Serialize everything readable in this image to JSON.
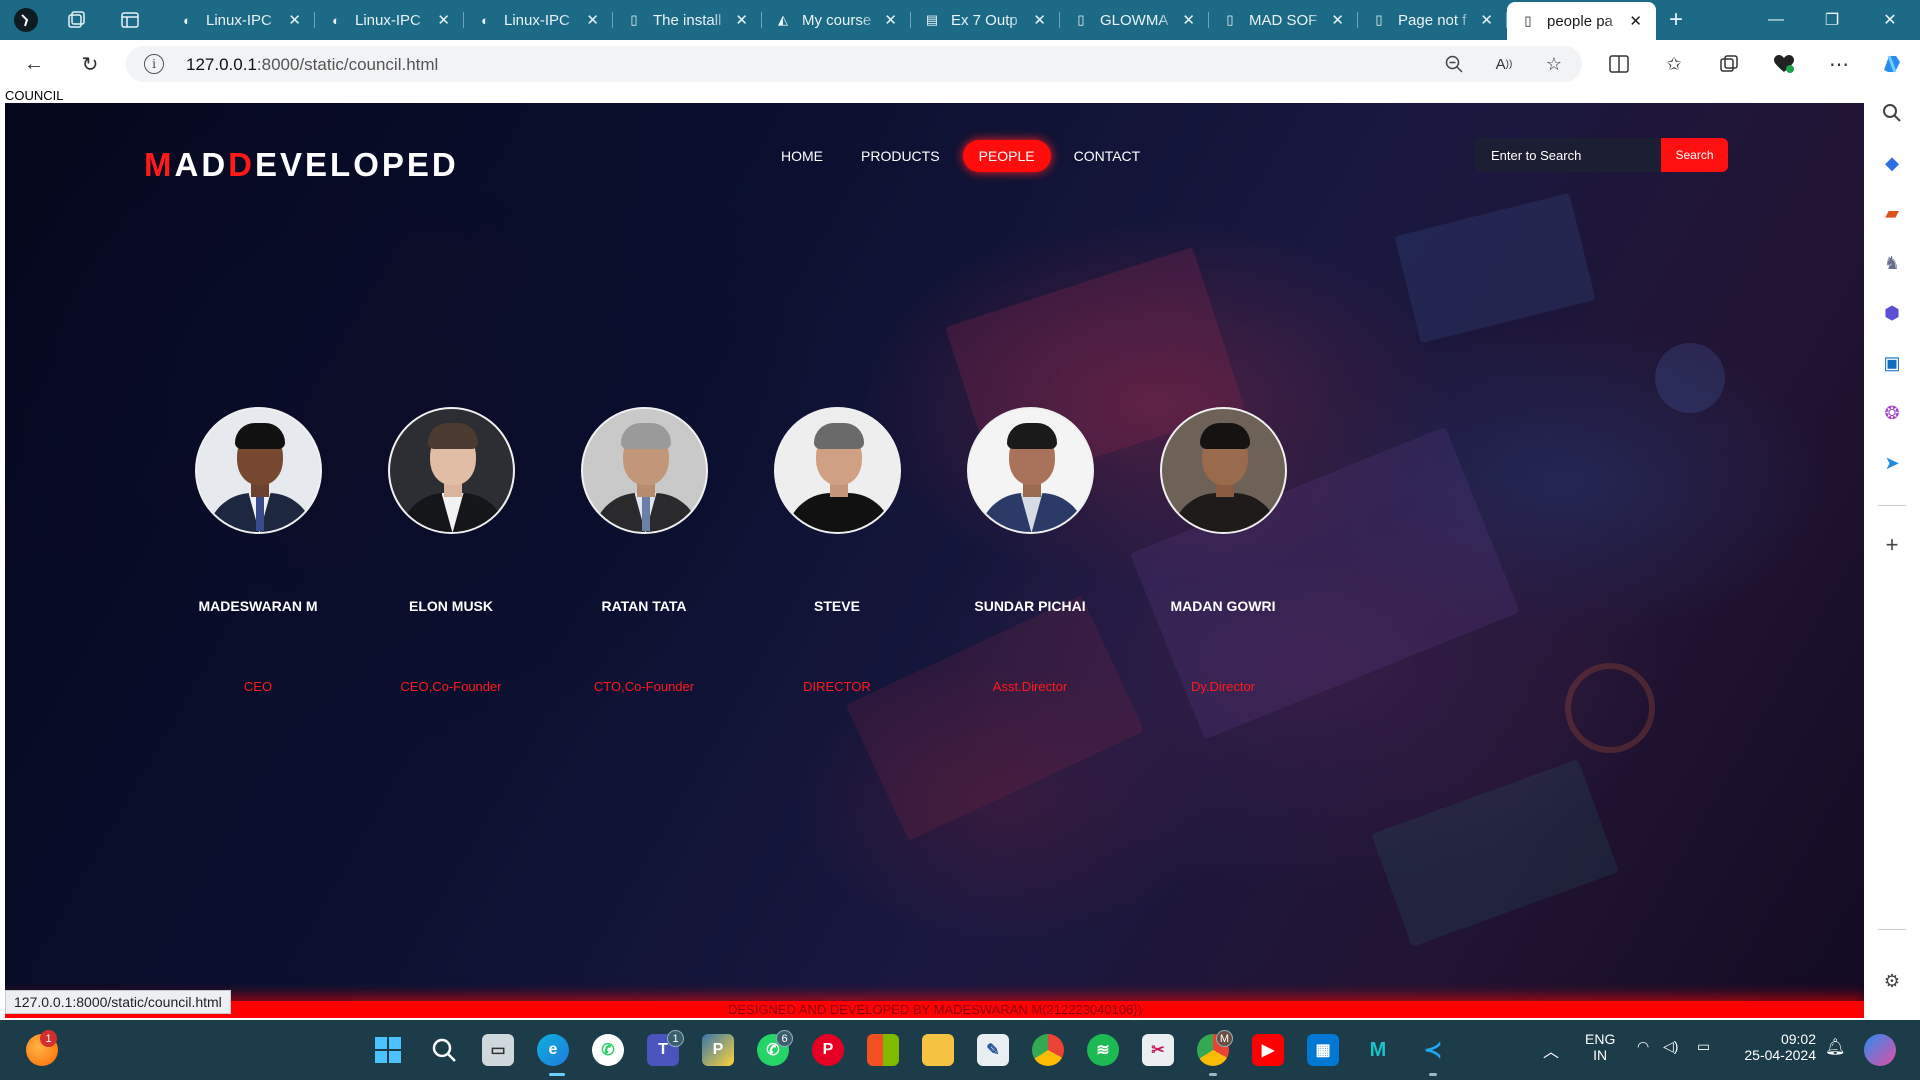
{
  "browser": {
    "tabs": [
      {
        "label": "Linux-IPC",
        "icon": "github-icon"
      },
      {
        "label": "Linux-IPC",
        "icon": "github-icon"
      },
      {
        "label": "Linux-IPC",
        "icon": "github-icon"
      },
      {
        "label": "The install",
        "icon": "page-icon"
      },
      {
        "label": "My course",
        "icon": "course-icon"
      },
      {
        "label": "Ex 7 Outp",
        "icon": "pdf-icon"
      },
      {
        "label": "GLOWMA",
        "icon": "page-icon"
      },
      {
        "label": "MAD SOF",
        "icon": "page-icon"
      },
      {
        "label": "Page not f",
        "icon": "page-icon"
      },
      {
        "label": "people pa",
        "icon": "page-icon",
        "active": true
      }
    ],
    "url_host": "127.0.0.1",
    "url_rest": ":8000/static/council.html",
    "status_url": "127.0.0.1:8000/static/council.html"
  },
  "page": {
    "doc_title": "COUNCIL",
    "brand": {
      "p1": "M",
      "p2": "AD",
      "p3": "D",
      "p4": "EVELOPED"
    },
    "nav": [
      "HOME",
      "PRODUCTS",
      "PEOPLE",
      "CONTACT"
    ],
    "nav_active": "PEOPLE",
    "search": {
      "placeholder": "Enter to Search",
      "button": "Search"
    },
    "members": [
      {
        "name": "MADESWARAN M",
        "role": "CEO"
      },
      {
        "name": "ELON MUSK",
        "role": "CEO,Co-Founder"
      },
      {
        "name": "RATAN TATA",
        "role": "CTO,Co-Founder"
      },
      {
        "name": "STEVE",
        "role": "DIRECTOR"
      },
      {
        "name": "SUNDAR PICHAI",
        "role": "Asst.Director"
      },
      {
        "name": "MADAN GOWRI",
        "role": "Dy.Director"
      }
    ],
    "footer": "DESIGNED AND DEVELOPED BY MADESWARAN M(212223040106})"
  },
  "taskbar": {
    "lang1": "ENG",
    "lang2": "IN",
    "time": "09:02",
    "date": "25-04-2024",
    "badges": {
      "orange": "1",
      "teams": "1",
      "whatsapp": "6",
      "chrome": "M"
    }
  },
  "colors": {
    "accent": "#ff0d0d",
    "tabbar": "#1c6a86",
    "taskbar": "#1c3c4a"
  }
}
